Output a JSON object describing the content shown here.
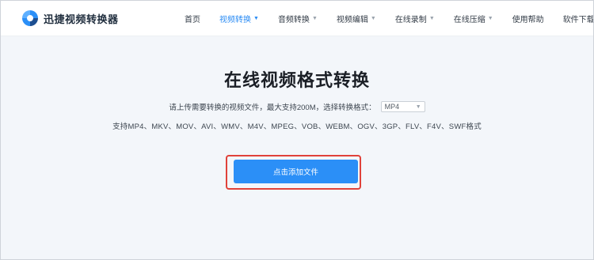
{
  "brand": {
    "name": "迅捷视频转换器"
  },
  "nav": {
    "items": [
      {
        "label": "首页",
        "dropdown": false,
        "active": false
      },
      {
        "label": "视频转换",
        "dropdown": true,
        "active": true
      },
      {
        "label": "音频转换",
        "dropdown": true,
        "active": false
      },
      {
        "label": "视频编辑",
        "dropdown": true,
        "active": false
      },
      {
        "label": "在线录制",
        "dropdown": true,
        "active": false
      },
      {
        "label": "在线压缩",
        "dropdown": true,
        "active": false
      },
      {
        "label": "使用帮助",
        "dropdown": false,
        "active": false
      },
      {
        "label": "软件下载",
        "dropdown": false,
        "active": false
      }
    ]
  },
  "hero": {
    "title": "在线视频格式转换",
    "upload_hint": "请上传需要转换的视频文件，最大支持200M，选择转换格式：",
    "format_select": {
      "value": "MP4",
      "icon": "chevron-down-icon"
    },
    "supported_formats": "支持MP4、MKV、MOV、AVI、WMV、M4V、MPEG、VOB、WEBM、OGV、3GP、FLV、F4V、SWF格式",
    "add_button": "点击添加文件"
  },
  "colors": {
    "accent": "#2b8ff7",
    "active_nav": "#2b8cf4",
    "highlight_border": "#e0423a",
    "page_bg": "#f3f6fa",
    "title": "#1b1f26"
  }
}
